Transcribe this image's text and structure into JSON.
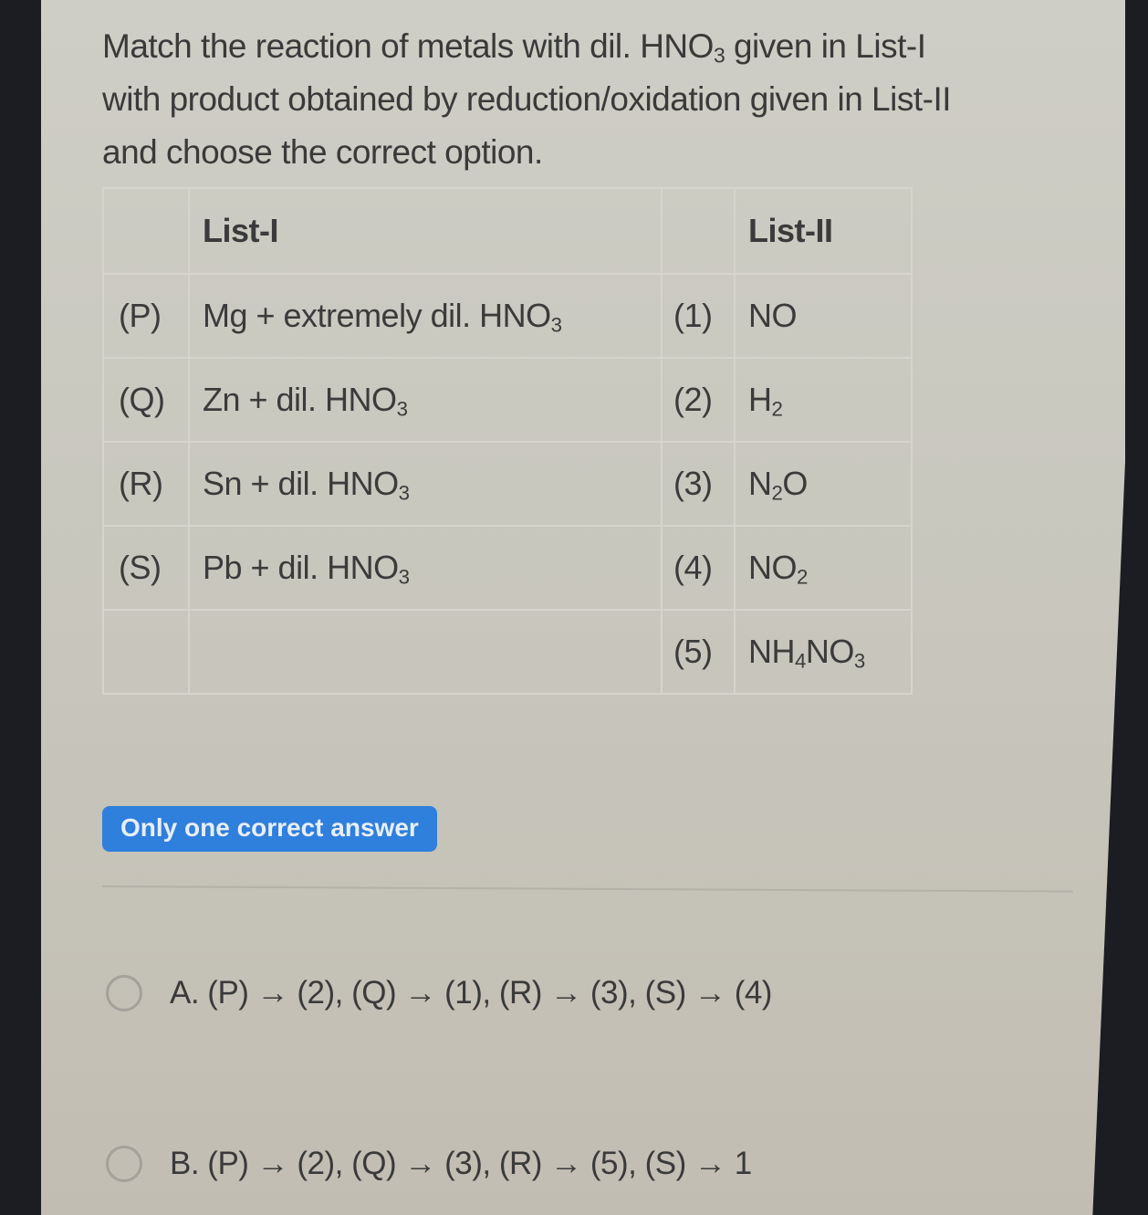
{
  "question": {
    "line1_pre": "Match the reaction of metals with dil. HNO",
    "line1_sub": "3",
    "line1_post": " given in List-I",
    "line2": "with product obtained by reduction/oxidation given in List-II",
    "line3": "and choose the correct option."
  },
  "table": {
    "header": {
      "list1": "List-I",
      "list2": "List-II"
    },
    "rows": [
      {
        "label": "(P)",
        "reactant": "Mg + extremely dil. HNO",
        "reactant_sub": "3",
        "num": "(1)",
        "product_parts": [
          "NO"
        ]
      },
      {
        "label": "(Q)",
        "reactant": "Zn + dil. HNO",
        "reactant_sub": "3",
        "num": "(2)",
        "product_parts": [
          "H",
          "2"
        ]
      },
      {
        "label": "(R)",
        "reactant": "Sn + dil. HNO",
        "reactant_sub": "3",
        "num": "(3)",
        "product_parts": [
          "N",
          "2",
          "O"
        ]
      },
      {
        "label": "(S)",
        "reactant": "Pb + dil. HNO",
        "reactant_sub": "3",
        "num": "(4)",
        "product_parts": [
          "NO",
          "2"
        ]
      },
      {
        "label": "",
        "reactant": "",
        "reactant_sub": "",
        "num": "(5)",
        "product_parts": [
          "NH",
          "4",
          "NO",
          "3"
        ]
      }
    ]
  },
  "badge": {
    "label": "Only one correct answer",
    "color": "#2f7fdc"
  },
  "options": [
    {
      "label": "A. (P) → (2), (Q) → (1), (R) → (3), (S) → (4)",
      "selected": false,
      "icon": "radio-empty-icon"
    },
    {
      "label": "B. (P) → (2), (Q) → (3), (R) → (5), (S) → 1",
      "selected": false,
      "icon": "radio-empty-icon"
    }
  ]
}
